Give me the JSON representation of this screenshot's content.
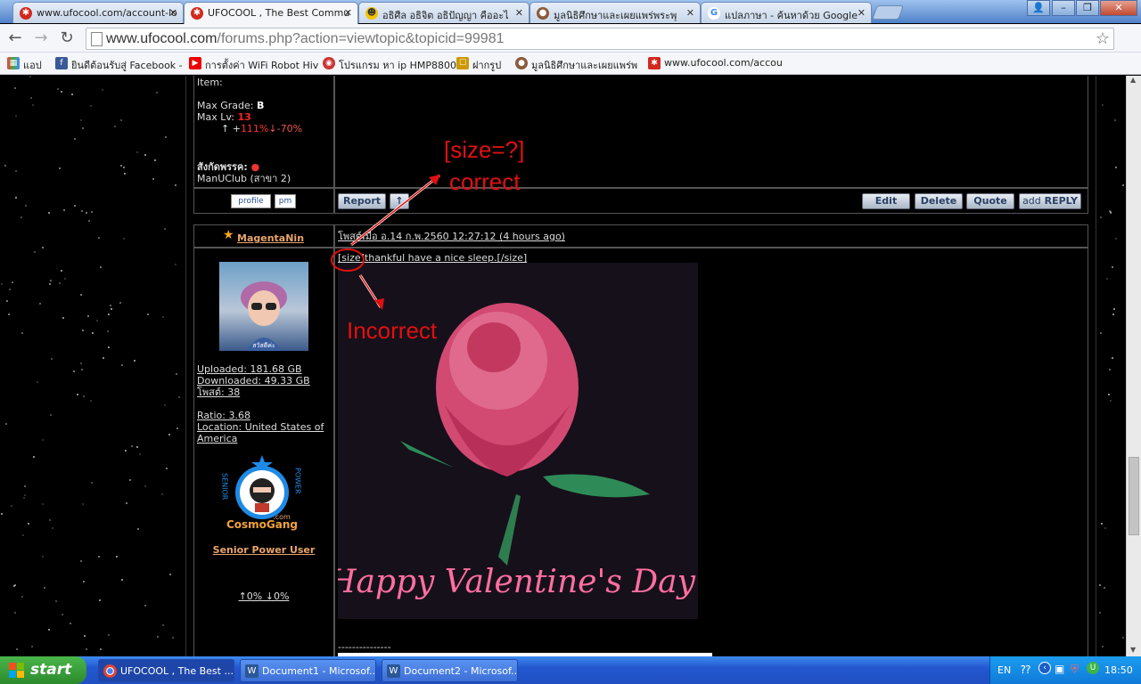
{
  "tabs": [
    {
      "title": "www.ufocool.com/account-lo",
      "icon_color": "#d3281e"
    },
    {
      "title": "UFOCOOL , The Best Commu",
      "icon_color": "#d3281e"
    },
    {
      "title": "อธิศีล อธิจิต อธิปัญญา คืออะไ",
      "icon_color": "#f2c200"
    },
    {
      "title": "มูลนิธิศึกษาและเผยแพร่พระพุ",
      "icon_color": "#8a5a3c"
    },
    {
      "title": "แปลภาษา - ค้นหาด้วย Google",
      "icon_color": "#4285f4"
    }
  ],
  "address": {
    "host": "www.ufocool.com",
    "path": "/forums.php?action=viewtopic&topicid=99981"
  },
  "bookmarks": [
    {
      "label": "แอป",
      "icon_color": "#e44"
    },
    {
      "label": "ยินดีต้อนรับสู่ Facebook -",
      "icon_color": "#3b5998"
    },
    {
      "label": "การตั้งค่า WiFi Robot Hiv",
      "icon_color": "#e00"
    },
    {
      "label": "โปรแกรม หา ip HMP8800",
      "icon_color": "#c33"
    },
    {
      "label": "ฝากรูป",
      "icon_color": "#c90"
    },
    {
      "label": "มูลนิธิศึกษาและเผยแพร่พ",
      "icon_color": "#8a5a3c"
    },
    {
      "label": "www.ufocool.com/accou",
      "icon_color": "#d3281e"
    }
  ],
  "prev_post": {
    "item_label": "Item:",
    "max_grade_label": "Max Grade:",
    "max_grade_value": "B",
    "max_lv_label": "Max Lv:",
    "max_lv_value": "13",
    "stat_up": "↑ +",
    "stat_up_value": "111%",
    "stat_down": "↓-70%",
    "affiliation_label": "สังกัดพรรค:",
    "club": "ManUClub (สาขา 2)",
    "profile_label": "profile",
    "pm_label": "pm",
    "report_label": "Report",
    "edit_label": "Edit",
    "delete_label": "Delete",
    "quote_label": "Quote",
    "add_label": "add",
    "reply_label": "REPLY"
  },
  "post": {
    "username": "MagentaNin",
    "posted": "โพสต์เมื่อ อ.14 ก.พ.2560 12:27:12 (4 hours ago)",
    "body_text": "[size]thankful have a nice sleep.[/size]",
    "uploaded": "Uploaded: 181.68 GB",
    "downloaded": "Downloaded: 49.33 GB",
    "posts": "โพสต์: 38",
    "ratio": "Ratio: 3.68",
    "location": "Location: United States of America",
    "badge_text": "CosmoGang",
    "badge_sub": ".com",
    "badge_left": "SENIOR",
    "badge_right": "POWER",
    "rank": "Senior Power User",
    "stats": "↑0% ↓0%",
    "avatar_caption": "สวัสดีค่ะ",
    "image_caption": "Happy Valentine's Day",
    "separator": "---------------"
  },
  "annotations": {
    "correct_line1": "[size=?]",
    "correct_line2": "correct",
    "incorrect": "Incorrect",
    "color": "#e01010"
  },
  "taskbar": {
    "start_label": "start",
    "tasks": [
      "UFOCOOL , The Best ...",
      "Document1 - Microsof...",
      "Document2 - Microsof..."
    ],
    "lang": "EN",
    "clock": "18:50"
  }
}
